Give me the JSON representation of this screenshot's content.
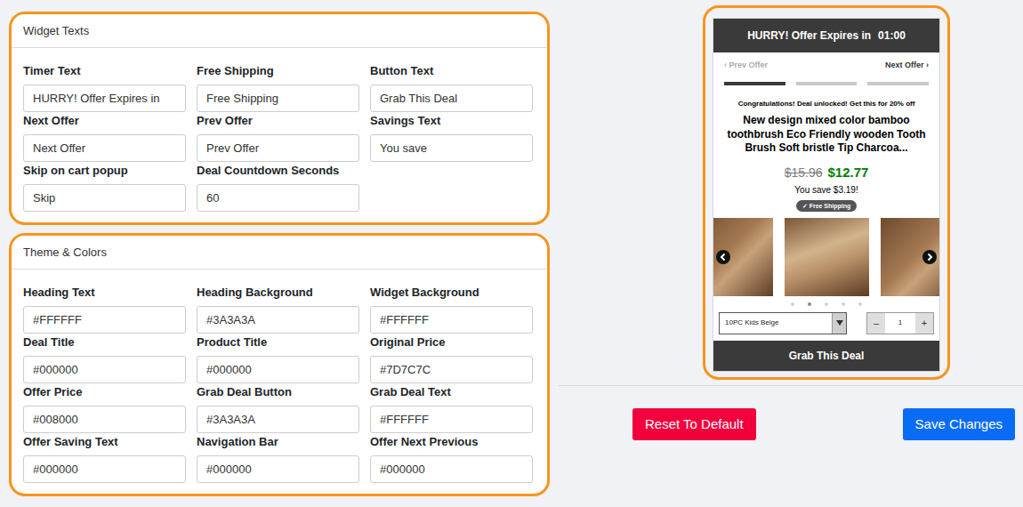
{
  "sections": [
    {
      "title": "Widget Texts",
      "fields": [
        {
          "label": "Timer Text",
          "value": "HURRY! Offer Expires in"
        },
        {
          "label": "Free Shipping",
          "value": "Free Shipping"
        },
        {
          "label": "Button Text",
          "value": "Grab This Deal"
        },
        {
          "label": "Next Offer",
          "value": "Next Offer"
        },
        {
          "label": "Prev Offer",
          "value": "Prev Offer"
        },
        {
          "label": "Savings Text",
          "value": "You save"
        },
        {
          "label": "Skip on cart popup",
          "value": "Skip"
        },
        {
          "label": "Deal Countdown Seconds",
          "value": "60"
        }
      ]
    },
    {
      "title": "Theme & Colors",
      "fields": [
        {
          "label": "Heading Text",
          "value": "#FFFFFF"
        },
        {
          "label": "Heading Background",
          "value": "#3A3A3A"
        },
        {
          "label": "Widget Background",
          "value": "#FFFFFF"
        },
        {
          "label": "Deal Title",
          "value": "#000000"
        },
        {
          "label": "Product Title",
          "value": "#000000"
        },
        {
          "label": "Original Price",
          "value": "#7D7C7C"
        },
        {
          "label": "Offer Price",
          "value": "#008000"
        },
        {
          "label": "Grab Deal Button",
          "value": "#3A3A3A"
        },
        {
          "label": "Grab Deal Text",
          "value": "#FFFFFF"
        },
        {
          "label": "Offer Saving Text",
          "value": "#000000"
        },
        {
          "label": "Navigation Bar",
          "value": "#000000"
        },
        {
          "label": "Offer Next Previous",
          "value": "#000000"
        }
      ]
    }
  ],
  "preview": {
    "timer_text": "HURRY! Offer Expires in",
    "timer": "01:00",
    "prev_offer": {
      "label": "‹ Prev Offer",
      "disabled": true
    },
    "next_offer": {
      "label": "Next Offer ›",
      "disabled": false
    },
    "progress": [
      {
        "selected": true
      },
      {
        "selected": false
      },
      {
        "selected": false
      }
    ],
    "deal_title": "Congratulations! Deal unlocked! Get this for 20% off",
    "product_title": "New design mixed color bamboo toothbrush Eco Friendly wooden Tooth Brush Soft bristle Tip Charcoa...",
    "original_price": "$15.96",
    "offer_price": "$12.77",
    "savings": "You save $3.19!",
    "free_shipping": "✓ Free Shipping",
    "dots": [
      {
        "selected": false
      },
      {
        "selected": true
      },
      {
        "selected": false
      },
      {
        "selected": false
      },
      {
        "selected": false
      }
    ],
    "variant": "10PC Kids Beige",
    "quantity_minus": "–",
    "quantity": "1",
    "quantity_plus": "+",
    "button": "Grab This Deal"
  },
  "buttons": [
    {
      "label": "Reset To Default",
      "kind": "danger"
    },
    {
      "label": "Save Changes",
      "kind": "primary"
    }
  ]
}
